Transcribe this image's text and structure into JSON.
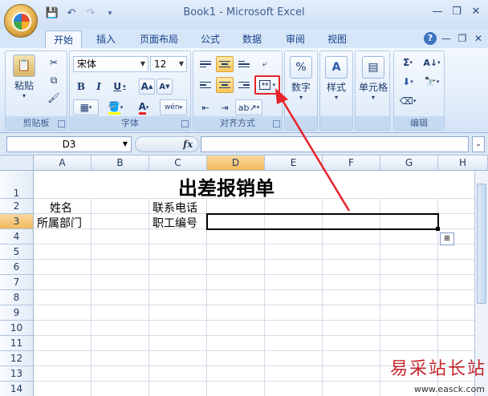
{
  "window": {
    "title": "Book1 - Microsoft Excel"
  },
  "quick_access": [
    {
      "icon": "save-icon",
      "glyph": "💾"
    },
    {
      "icon": "undo-icon",
      "glyph": "↶"
    },
    {
      "icon": "redo-icon",
      "glyph": "↷"
    },
    {
      "icon": "customize-icon",
      "glyph": "▾"
    }
  ],
  "window_controls": {
    "minimize": "—",
    "restore": "❐",
    "close": "✕"
  },
  "tabs": [
    "开始",
    "插入",
    "页面布局",
    "公式",
    "数据",
    "审阅",
    "视图"
  ],
  "active_tab": "开始",
  "ribbon": {
    "clipboard": {
      "label": "剪贴板",
      "paste": "粘贴"
    },
    "font": {
      "label": "字体",
      "font_name": "宋体",
      "font_size": "12",
      "bold": "B",
      "italic": "I",
      "underline": "U",
      "grow": "A",
      "shrink": "A",
      "phonetic": "wén"
    },
    "alignment": {
      "label": "对齐方式"
    },
    "number": {
      "label": "数字",
      "format_icon": "%"
    },
    "styles": {
      "label": "样式"
    },
    "cells": {
      "label": "单元格"
    },
    "editing": {
      "label": "编辑",
      "sum": "Σ"
    }
  },
  "formula_bar": {
    "name_box": "D3",
    "fx": "fx",
    "value": ""
  },
  "columns": [
    "A",
    "B",
    "C",
    "D",
    "E",
    "F",
    "G",
    "H"
  ],
  "rows": [
    "1",
    "2",
    "3",
    "4",
    "5",
    "6",
    "7",
    "8",
    "9",
    "10",
    "11",
    "12",
    "13",
    "14"
  ],
  "selected": {
    "column": "D",
    "row": "3"
  },
  "sheet": {
    "title": "出差报销单",
    "a2": "姓名",
    "a3": "所属部门",
    "c2": "联系电话",
    "c3": "职工编号"
  },
  "watermark": {
    "text": "易采站长站",
    "url": "www.easck.com"
  },
  "colors": {
    "accent": "#15428b",
    "highlight": "#f9c75c",
    "annotation": "#e8232a"
  }
}
